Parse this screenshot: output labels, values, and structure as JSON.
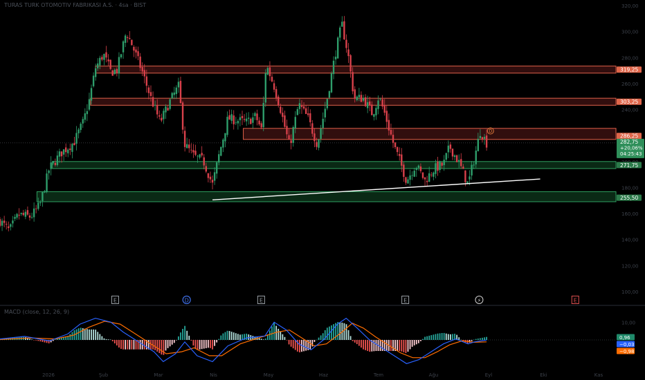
{
  "header": {
    "title": "TURAS TURK OTOMOTIV FABRIKASI A.S. · 4sa · BIST"
  },
  "macd_indicator": {
    "title": "MACD (close, 12, 26, 9)"
  },
  "colors": {
    "background": "#000000",
    "up": "#2e9e6b",
    "down": "#d9414b",
    "resistance_fill": "#5a1a1a",
    "resistance_border": "#e0604a",
    "support_fill": "#124a26",
    "support_border": "#2fa060",
    "trendline": "#ffffff",
    "macd_line": "#2962ff",
    "signal_line": "#ff6d00"
  },
  "chart_data": [
    {
      "type": "candlestick",
      "y_axis_ticks": [
        "320,00",
        "300,00",
        "280,00",
        "260,00",
        "240,00",
        "220,00",
        "200,00",
        "180,00",
        "160,00",
        "140,00",
        "120,00",
        "100,00"
      ],
      "x_axis_ticks": [
        "2026",
        "Şub",
        "Mar",
        "Nis",
        "May",
        "Haz",
        "Tem",
        "Ağu",
        "Eyl",
        "Eki",
        "Kas"
      ],
      "price_labels": [
        {
          "text": "319,25",
          "kind": "resistance"
        },
        {
          "text": "303,25",
          "kind": "resistance"
        },
        {
          "text": "286,25",
          "kind": "resistance"
        },
        {
          "text": "282,75",
          "kind": "current"
        },
        {
          "text": "+20,06%",
          "kind": "current"
        },
        {
          "text": "04:25:43",
          "kind": "current"
        },
        {
          "text": "271,75",
          "kind": "support"
        },
        {
          "text": "255,50",
          "kind": "support"
        }
      ],
      "zones": [
        {
          "kind": "resistance",
          "low": 317.5,
          "high": 321.0
        },
        {
          "kind": "resistance",
          "low": 301.5,
          "high": 305.0
        },
        {
          "kind": "resistance",
          "low": 284.5,
          "high": 290.0
        },
        {
          "kind": "support",
          "low": 270.0,
          "high": 273.5
        },
        {
          "kind": "support",
          "low": 253.5,
          "high": 258.5
        }
      ],
      "trendline": {
        "from": [
          0.345,
          254.4
        ],
        "to": [
          0.877,
          264.8
        ]
      },
      "current_price": 282.75,
      "price_range": [
        202.6,
        352.5
      ],
      "close_path": [
        [
          0.0,
          244
        ],
        [
          0.015,
          239
        ],
        [
          0.03,
          247
        ],
        [
          0.05,
          246
        ],
        [
          0.065,
          252
        ],
        [
          0.08,
          270
        ],
        [
          0.1,
          278
        ],
        [
          0.12,
          283
        ],
        [
          0.135,
          293
        ],
        [
          0.145,
          304
        ],
        [
          0.155,
          320
        ],
        [
          0.168,
          327
        ],
        [
          0.18,
          318
        ],
        [
          0.19,
          319
        ],
        [
          0.205,
          338
        ],
        [
          0.215,
          331
        ],
        [
          0.23,
          319
        ],
        [
          0.245,
          305
        ],
        [
          0.26,
          293
        ],
        [
          0.275,
          303
        ],
        [
          0.29,
          311
        ],
        [
          0.3,
          282
        ],
        [
          0.315,
          276
        ],
        [
          0.33,
          274
        ],
        [
          0.345,
          262
        ],
        [
          0.355,
          276
        ],
        [
          0.37,
          295
        ],
        [
          0.385,
          294
        ],
        [
          0.4,
          293
        ],
        [
          0.415,
          296
        ],
        [
          0.425,
          289
        ],
        [
          0.432,
          322
        ],
        [
          0.445,
          311
        ],
        [
          0.455,
          300
        ],
        [
          0.47,
          281
        ],
        [
          0.485,
          302
        ],
        [
          0.5,
          295
        ],
        [
          0.515,
          282
        ],
        [
          0.53,
          303
        ],
        [
          0.545,
          328
        ],
        [
          0.555,
          342
        ],
        [
          0.565,
          327
        ],
        [
          0.575,
          305
        ],
        [
          0.59,
          305
        ],
        [
          0.605,
          297
        ],
        [
          0.615,
          306
        ],
        [
          0.625,
          297
        ],
        [
          0.64,
          281
        ],
        [
          0.65,
          273
        ],
        [
          0.66,
          264
        ],
        [
          0.675,
          272
        ],
        [
          0.69,
          264
        ],
        [
          0.705,
          270
        ],
        [
          0.72,
          272
        ],
        [
          0.73,
          281
        ],
        [
          0.745,
          273
        ],
        [
          0.76,
          262
        ],
        [
          0.77,
          275
        ],
        [
          0.78,
          289
        ],
        [
          0.79,
          282.75
        ]
      ],
      "events": [
        {
          "symbol": "E",
          "x": 0.187,
          "color": "#9aa0a6"
        },
        {
          "symbol": "D",
          "x": 0.303,
          "color": "#3f6fe8"
        },
        {
          "symbol": "E",
          "x": 0.424,
          "color": "#9aa0a6"
        },
        {
          "symbol": "E",
          "x": 0.658,
          "color": "#9aa0a6"
        },
        {
          "symbol": "⚡",
          "x": 0.778,
          "color": "#cfcfcf"
        },
        {
          "symbol": "E",
          "x": 0.934,
          "color": "#e05050"
        }
      ],
      "candle_marker": {
        "symbol": "D",
        "x": 0.793,
        "value": 287.0
      }
    },
    {
      "type": "macd",
      "value_labels": [
        {
          "text": "0,96",
          "kind": "histogram"
        },
        {
          "text": "−0,03",
          "kind": "macd"
        },
        {
          "text": "−0,98",
          "kind": "signal"
        }
      ],
      "y_tick": "10,00",
      "range": [
        -14,
        14
      ],
      "macd_path": [
        [
          0.0,
          0.5
        ],
        [
          0.04,
          1.8
        ],
        [
          0.08,
          -0.5
        ],
        [
          0.11,
          3
        ],
        [
          0.13,
          8
        ],
        [
          0.155,
          11
        ],
        [
          0.18,
          9
        ],
        [
          0.2,
          4
        ],
        [
          0.225,
          -1
        ],
        [
          0.25,
          -6
        ],
        [
          0.265,
          -11
        ],
        [
          0.285,
          -7
        ],
        [
          0.3,
          -1
        ],
        [
          0.32,
          -8
        ],
        [
          0.345,
          -11
        ],
        [
          0.37,
          -3
        ],
        [
          0.4,
          1
        ],
        [
          0.43,
          2
        ],
        [
          0.445,
          9
        ],
        [
          0.465,
          5
        ],
        [
          0.485,
          -2
        ],
        [
          0.505,
          -5
        ],
        [
          0.525,
          0
        ],
        [
          0.548,
          8
        ],
        [
          0.562,
          11
        ],
        [
          0.58,
          6
        ],
        [
          0.6,
          0
        ],
        [
          0.62,
          -4
        ],
        [
          0.64,
          -8
        ],
        [
          0.66,
          -12
        ],
        [
          0.68,
          -10
        ],
        [
          0.7,
          -6
        ],
        [
          0.72,
          -2
        ],
        [
          0.74,
          0.5
        ],
        [
          0.76,
          -2
        ],
        [
          0.77,
          -1
        ],
        [
          0.79,
          -0.03
        ]
      ],
      "signal_path": [
        [
          0.0,
          0.2
        ],
        [
          0.05,
          1.0
        ],
        [
          0.09,
          0.5
        ],
        [
          0.12,
          2.5
        ],
        [
          0.145,
          6.5
        ],
        [
          0.17,
          9.5
        ],
        [
          0.195,
          8
        ],
        [
          0.22,
          3
        ],
        [
          0.245,
          -2
        ],
        [
          0.27,
          -7
        ],
        [
          0.295,
          -6
        ],
        [
          0.315,
          -4
        ],
        [
          0.34,
          -8
        ],
        [
          0.36,
          -8
        ],
        [
          0.39,
          -2
        ],
        [
          0.42,
          1
        ],
        [
          0.45,
          4
        ],
        [
          0.47,
          5
        ],
        [
          0.49,
          1
        ],
        [
          0.51,
          -3
        ],
        [
          0.53,
          -2
        ],
        [
          0.555,
          4
        ],
        [
          0.572,
          8.5
        ],
        [
          0.59,
          6
        ],
        [
          0.61,
          1.5
        ],
        [
          0.63,
          -2.5
        ],
        [
          0.65,
          -6.5
        ],
        [
          0.67,
          -9
        ],
        [
          0.69,
          -9
        ],
        [
          0.71,
          -6
        ],
        [
          0.73,
          -2.5
        ],
        [
          0.75,
          -0.5
        ],
        [
          0.77,
          -1.2
        ],
        [
          0.79,
          -0.98
        ]
      ]
    }
  ]
}
